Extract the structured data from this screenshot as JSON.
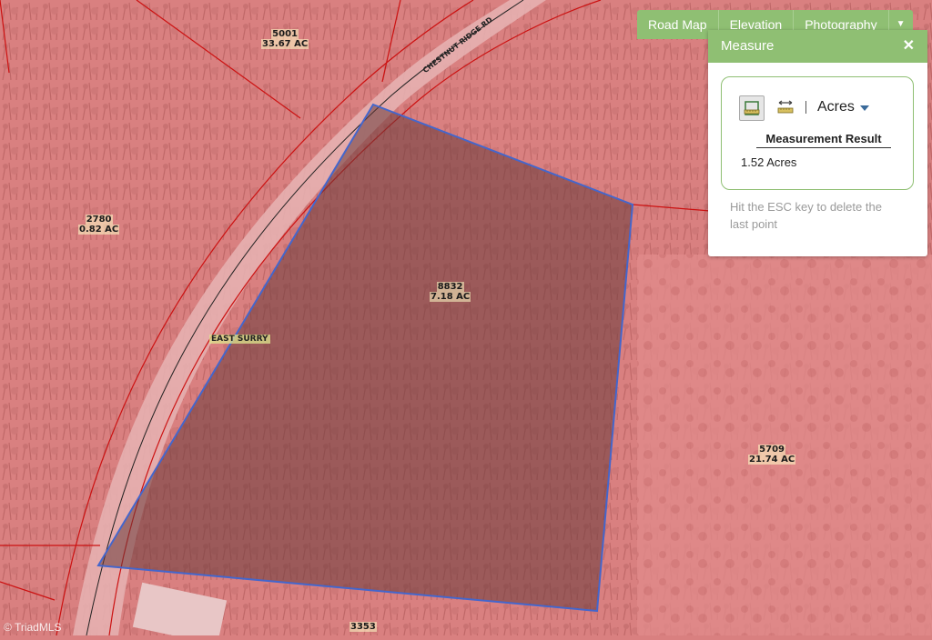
{
  "map": {
    "parcels": [
      {
        "id": "5001",
        "area": "33.67 AC"
      },
      {
        "id": "2780",
        "area": "0.82 AC"
      },
      {
        "id": "8832",
        "area": "7.18 AC"
      },
      {
        "id": "5709",
        "area": "21.74 AC"
      },
      {
        "id": "3353",
        "area": ""
      }
    ],
    "area_label": "EAST SURRY",
    "road_label": "CHESTNUT RIDGE RD",
    "watermark": "© TriadMLS",
    "colors": {
      "parcel_fill": "#d98080",
      "parcel_line": "#cc1111",
      "measure_outline": "#4466cc",
      "measure_fill": "#6a3a3a"
    }
  },
  "map_tabs": [
    "Road Map",
    "Elevation",
    "Photography"
  ],
  "map_tabs_dropdown_icon": "caret-down-icon",
  "measure": {
    "title": "Measure",
    "close_icon": "close-icon",
    "unit": "Acres",
    "result_title": "Measurement Result",
    "result_value": "1.52 Acres",
    "hint": "Hit the ESC key to delete the last point",
    "accent_color": "#8fbf73"
  }
}
